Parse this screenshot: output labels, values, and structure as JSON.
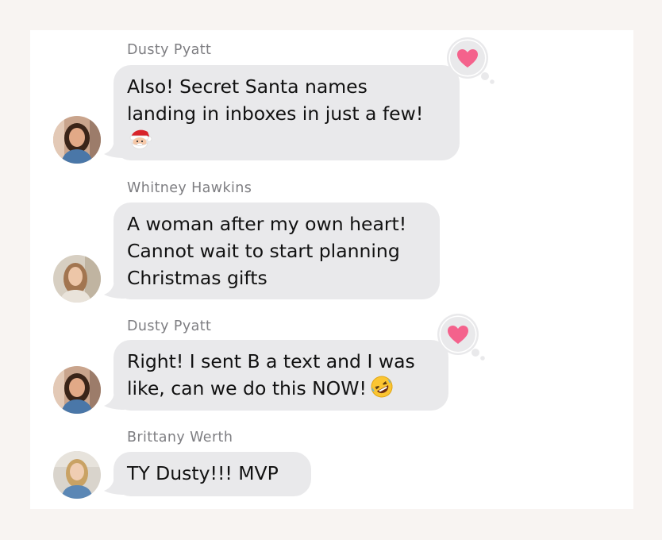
{
  "messages": [
    {
      "sender": "Dusty Pyatt",
      "lines": [
        "Also! Secret Santa names",
        "landing in inboxes in just a few!"
      ],
      "emoji": "santa-emoji",
      "reaction": "heart"
    },
    {
      "sender": "Whitney Hawkins",
      "lines": [
        "A woman after my own heart!",
        "Cannot wait to start planning",
        "Christmas gifts"
      ]
    },
    {
      "sender": "Dusty Pyatt",
      "lines": [
        "Right! I sent B a text and I was",
        "like, can we do this NOW!"
      ],
      "emoji": "rofl-emoji",
      "reaction": "heart"
    },
    {
      "sender": "Brittany Werth",
      "lines": [
        "TY Dusty!!! MVP"
      ]
    }
  ],
  "colors": {
    "background": "#f8f4f2",
    "card": "#ffffff",
    "bubble": "#e9e9eb",
    "sender_text": "#7e7e82",
    "heart": "#f4628c"
  }
}
